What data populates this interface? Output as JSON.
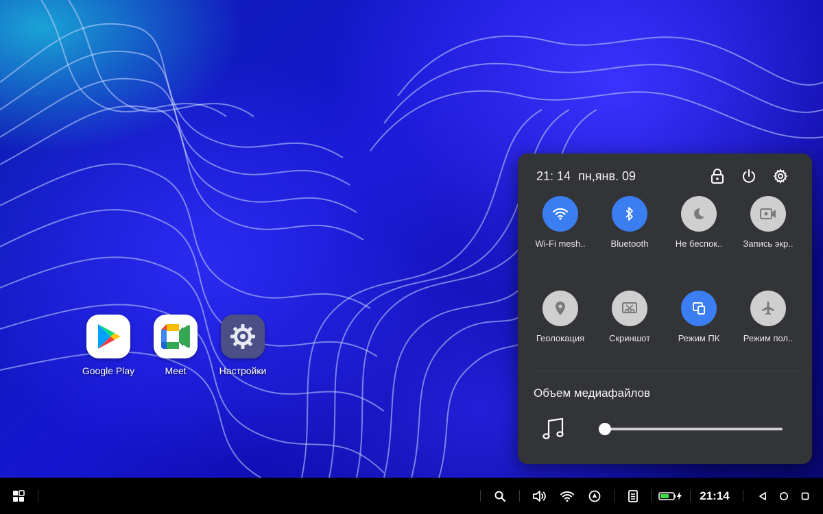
{
  "desktop": {
    "apps": [
      {
        "label": "Google Play",
        "icon": "google-play-icon"
      },
      {
        "label": "Meet",
        "icon": "google-meet-icon"
      },
      {
        "label": "Настройки",
        "icon": "gear-icon"
      }
    ]
  },
  "quick_settings": {
    "time": "21: 14",
    "date": "пн,янв. 09",
    "header_icons": [
      "lock-icon",
      "power-icon",
      "gear-icon"
    ],
    "tiles": [
      {
        "label": "Wi-Fi mesh..",
        "icon": "wifi-icon",
        "active": true
      },
      {
        "label": "Bluetooth",
        "icon": "bluetooth-icon",
        "active": true
      },
      {
        "label": "Не беспок..",
        "icon": "moon-icon",
        "active": false
      },
      {
        "label": "Запись экр..",
        "icon": "screen-record-icon",
        "active": false
      },
      {
        "label": "Геолокация",
        "icon": "location-pin-icon",
        "active": false
      },
      {
        "label": "Скриншот",
        "icon": "screenshot-icon",
        "active": false
      },
      {
        "label": "Режим ПК",
        "icon": "pc-mode-icon",
        "active": true
      },
      {
        "label": "Режим пол..",
        "icon": "airplane-icon",
        "active": false
      }
    ],
    "volume": {
      "title": "Объем медиафайлов",
      "icon": "music-note-icon",
      "level": 0
    }
  },
  "taskbar": {
    "start_icon": "grid-icon",
    "tray_icons": [
      "search-icon",
      "volume-icon",
      "wifi-icon",
      "navigation-icon",
      "notes-icon",
      "battery-charging-icon"
    ],
    "clock": "21:14",
    "nav_icons": [
      "back-icon",
      "home-icon",
      "recents-icon"
    ]
  },
  "colors": {
    "panel_bg": "#333438",
    "tile_active": "#3a7ef2",
    "tile_inactive": "#cfcfcf",
    "battery_green": "#3ddc48"
  }
}
